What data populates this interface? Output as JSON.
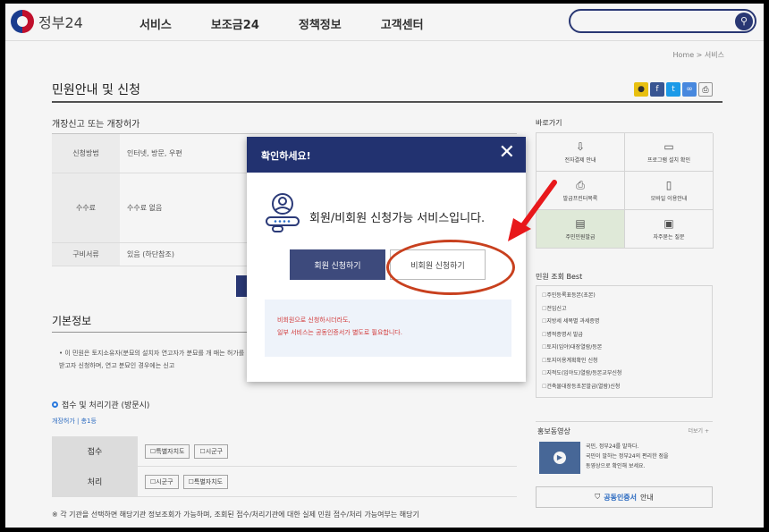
{
  "header": {
    "logo_text": "정부24",
    "nav": [
      "서비스",
      "보조금24",
      "정책정보",
      "고객센터"
    ],
    "search_placeholder": ""
  },
  "breadcrumb": "Home > 서비스",
  "page_title": "민원안내 및 신청",
  "section_title": "개장신고 또는 개장허가",
  "info_table": [
    {
      "label": "신청방법",
      "value": "인터넷, 방문, 우편"
    },
    {
      "label": "수수료",
      "value": "수수료 없음"
    },
    {
      "label": "구비서류",
      "value": "있음 (하단참조)"
    }
  ],
  "basic_info": {
    "title": "기본정보",
    "text": "이 민원은 토지소유자(분묘의 설치자 연고자가 분묘를 개 매는 허가를 받고자 신청하며, 연고 분묘인 경우에는 신고"
  },
  "reception": {
    "title": "접수 및 처리기관 (방문시)",
    "sub": "개장허가 | 총1등",
    "rows": [
      {
        "label": "접수",
        "chips": [
          "특별자치도",
          "시군구"
        ]
      },
      {
        "label": "처리",
        "chips": [
          "시군구",
          "특별자치도"
        ]
      }
    ]
  },
  "notice": "※ 각 기관을 선택하면 해당기관 정보조회가 가능하며, 조회된 접수/처리기관에 대한 실제 민원 접수/처리 가능여부는 해당기",
  "sidebar": {
    "quick_title": "바로가기",
    "quick_items": [
      {
        "icon": "⇩",
        "label": "전자결제 안내"
      },
      {
        "icon": "▭",
        "label": "프로그램 설치 확인"
      },
      {
        "icon": "⎙",
        "label": "발급프린터목록"
      },
      {
        "icon": "▯",
        "label": "모바일 이용안내"
      },
      {
        "icon": "▤",
        "label": "주민민원발급"
      },
      {
        "icon": "▣",
        "label": "자주묻는 질문"
      }
    ],
    "best_title": "민원 조회 Best",
    "best_items": [
      "주민등록표등본(초본)",
      "전입신고",
      "지방세 세목별 과세증명",
      "병적증명서 발급",
      "토지(임야)대장열람/등본",
      "토지이용계획확인 신청",
      "지적도(임야도)열람/등본교부신청",
      "건축물대장등초본발급(열람)신청"
    ],
    "promo_title": "홍보동영상",
    "promo_more": "더보기 +",
    "promo_text": [
      "국민, 정부24를 말하다.",
      "국민이 말하는 정부24의 편리한 점을",
      "동영상으로 확인해 보세요."
    ],
    "cert_label": "공동인증서",
    "cert_suffix": "안내"
  },
  "modal": {
    "title": "확인하세요!",
    "message": "회원/비회원 신청가능 서비스입니다.",
    "member_button": "회원 신청하기",
    "guest_button": "비회원 신청하기",
    "info_lines": [
      "비회원으로 신청하시더라도,",
      "일부 서비스는 공동인증서가 별도로 필요합니다."
    ]
  },
  "colors": {
    "navy": "#223270",
    "annotation": "#c8401e",
    "arrow": "#e8181b"
  }
}
